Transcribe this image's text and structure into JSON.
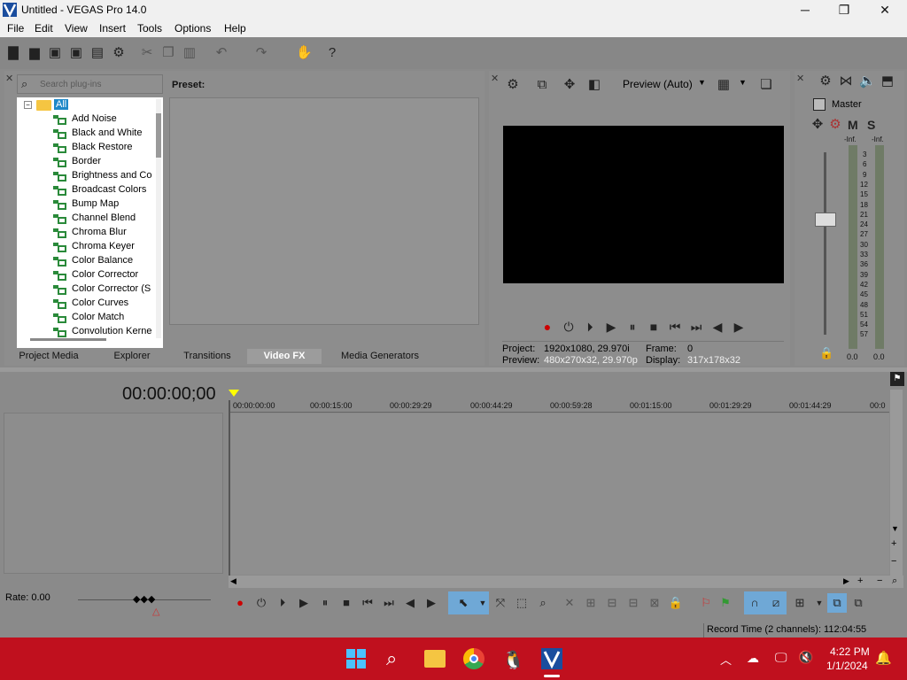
{
  "window": {
    "title": "Untitled - VEGAS Pro 14.0",
    "minimize": "─",
    "maximize": "❐",
    "close": "✕"
  },
  "menu": [
    "File",
    "Edit",
    "View",
    "Insert",
    "Tools",
    "Options",
    "Help"
  ],
  "plugins": {
    "search_placeholder": "Search plug-ins",
    "preset_label": "Preset:",
    "root_label": "All",
    "items": [
      "Add Noise",
      "Black and White",
      "Black Restore",
      "Border",
      "Brightness and Co",
      "Broadcast Colors",
      "Bump Map",
      "Channel Blend",
      "Chroma Blur",
      "Chroma Keyer",
      "Color Balance",
      "Color Corrector",
      "Color Corrector (S",
      "Color Curves",
      "Color Match",
      "Convolution Kerne"
    ],
    "tabs": [
      "Project Media",
      "Explorer",
      "Transitions",
      "Video FX",
      "Media Generators"
    ],
    "active_tab": "Video FX"
  },
  "preview": {
    "mode_label": "Preview (Auto)",
    "project_label": "Project:",
    "project_value": "1920x1080, 29.970i",
    "preview_label": "Preview:",
    "preview_value": "480x270x32, 29.970p",
    "frame_label": "Frame:",
    "frame_value": "0",
    "display_label": "Display:",
    "display_value": "317x178x32"
  },
  "mixer": {
    "master_label": "Master",
    "m_label": "M",
    "s_label": "S",
    "inf_left": "-Inf.",
    "inf_right": "-Inf.",
    "scale": [
      "3",
      "6",
      "9",
      "12",
      "15",
      "18",
      "21",
      "24",
      "27",
      "30",
      "33",
      "36",
      "39",
      "42",
      "45",
      "48",
      "51",
      "54",
      "57"
    ],
    "level_left": "0.0",
    "level_right": "0.0"
  },
  "timeline": {
    "timecode": "00:00:00;00",
    "ruler": [
      "00:00:00:00",
      "00:00:15:00",
      "00:00:29:29",
      "00:00:44:29",
      "00:00:59:28",
      "00:01:15:00",
      "00:01:29:29",
      "00:01:44:29",
      "00:0"
    ],
    "rate_label": "Rate: 0.00"
  },
  "status": {
    "record_time": "Record Time (2 channels): 112:04:55"
  },
  "taskbar": {
    "time": "4:22 PM",
    "date": "1/1/2024"
  },
  "colors": {
    "taskbar": "#c0101e",
    "selection": "#1e88c8",
    "accent_blue": "#3c8fd6"
  }
}
